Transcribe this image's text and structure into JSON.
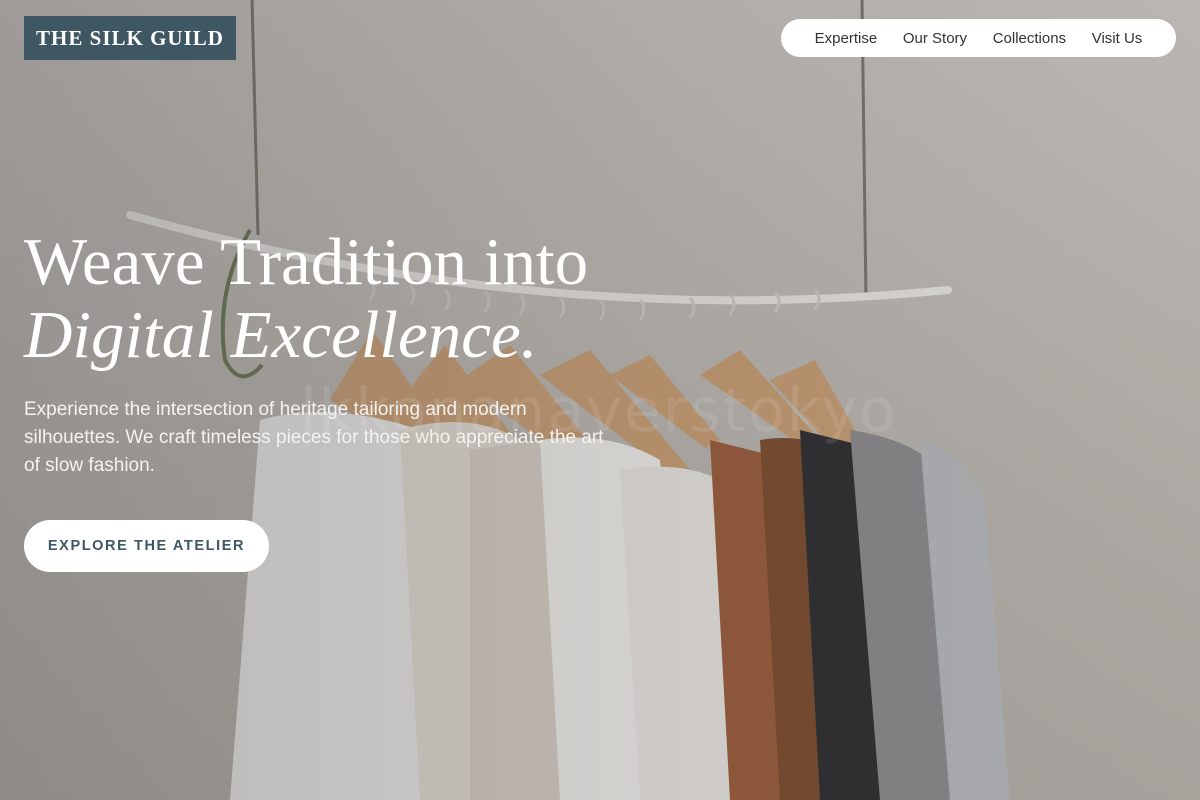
{
  "brand": {
    "name": "THE SILK GUILD"
  },
  "nav": {
    "items": [
      "Expertise",
      "Our Story",
      "Collections",
      "Visit Us"
    ]
  },
  "hero": {
    "headline_line1": "Weave Tradition into",
    "headline_line2": "Digital Excellence.",
    "subtext": "Experience the intersection of heritage tailoring and modern silhouettes. We craft timeless pieces for those who appreciate the art of slow fashion.",
    "cta_label": "EXPLORE THE ATELIER",
    "watermark": "lkkonanaverstokyo"
  },
  "colors": {
    "brand": "#3f5663",
    "nav_bg": "#ffffff",
    "text_on_hero": "#ffffff"
  }
}
